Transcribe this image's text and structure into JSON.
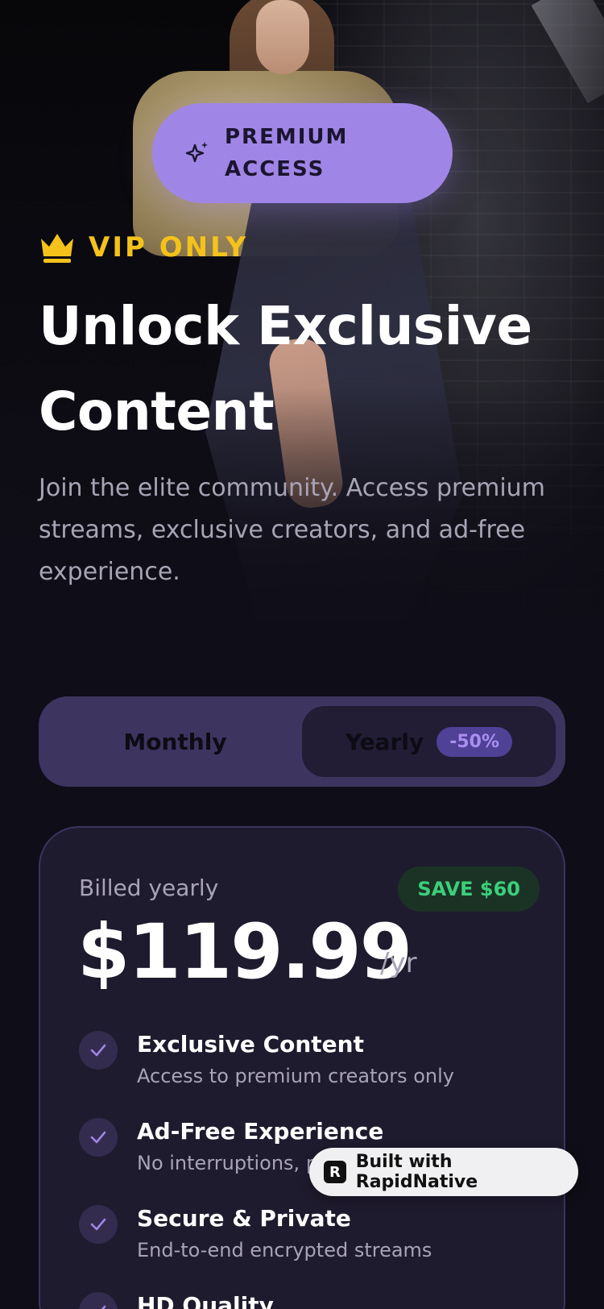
{
  "hero": {
    "pill_label": "PREMIUM ACCESS",
    "vip_label": "VIP ONLY",
    "title": "Unlock Exclusive Content",
    "subtitle": "Join the elite community. Access premium streams, exclusive creators, and ad-free experience."
  },
  "billing_toggle": {
    "monthly_label": "Monthly",
    "yearly_label": "Yearly",
    "yearly_badge": "-50%",
    "selected": "Yearly"
  },
  "plan": {
    "billed_label": "Billed yearly",
    "save_badge": "SAVE $60",
    "price": "$119.99",
    "period": "/yr",
    "features": [
      {
        "title": "Exclusive Content",
        "desc": "Access to premium creators only"
      },
      {
        "title": "Ad-Free Experience",
        "desc": "No interruptions, pr"
      },
      {
        "title": "Secure & Private",
        "desc": "End-to-end encrypted streams"
      },
      {
        "title": "HD Quality",
        "desc": ""
      }
    ]
  },
  "built_badge": {
    "label": "Built with RapidNative"
  },
  "colors": {
    "accent": "#9f86e6",
    "gold": "#f4c21a",
    "save_green": "#3ccf7b",
    "card_bg": "#1f1b2e",
    "page_bg": "#0f0d17"
  },
  "icons": [
    "sparkle-icon",
    "crown-icon",
    "check-icon",
    "rapidnative-logo-icon"
  ]
}
